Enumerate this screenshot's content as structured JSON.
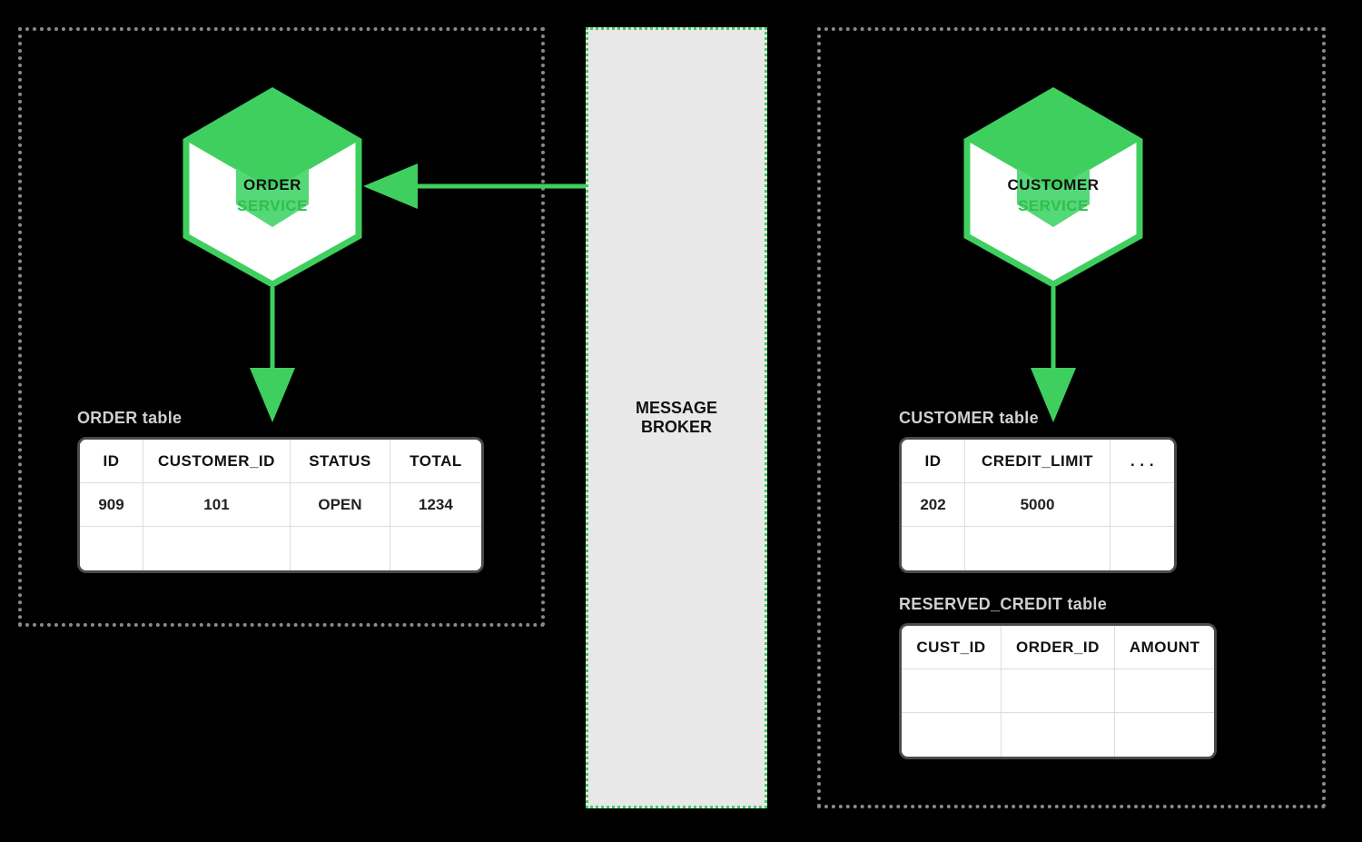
{
  "left_service": {
    "name_line1": "ORDER",
    "name_line2": "SERVICE"
  },
  "right_service": {
    "name_line1": "CUSTOMER",
    "name_line2": "SERVICE"
  },
  "broker": {
    "line1": "MESSAGE",
    "line2": "BROKER"
  },
  "order_table": {
    "title": "ORDER table",
    "headers": [
      "ID",
      "CUSTOMER_ID",
      "STATUS",
      "TOTAL"
    ],
    "rows": [
      [
        "909",
        "101",
        "OPEN",
        "1234"
      ],
      [
        "",
        "",
        "",
        ""
      ]
    ]
  },
  "customer_table": {
    "title": "CUSTOMER table",
    "headers": [
      "ID",
      "CREDIT_LIMIT",
      ". . ."
    ],
    "rows": [
      [
        "202",
        "5000",
        ""
      ],
      [
        "",
        "",
        ""
      ]
    ]
  },
  "reserved_credit_table": {
    "title": "RESERVED_CREDIT table",
    "headers": [
      "CUST_ID",
      "ORDER_ID",
      "AMOUNT"
    ],
    "rows": [
      [
        "",
        "",
        ""
      ],
      [
        "",
        "",
        ""
      ]
    ]
  },
  "colors": {
    "green": "#3fcf5f",
    "green_dark": "#2aa745"
  }
}
